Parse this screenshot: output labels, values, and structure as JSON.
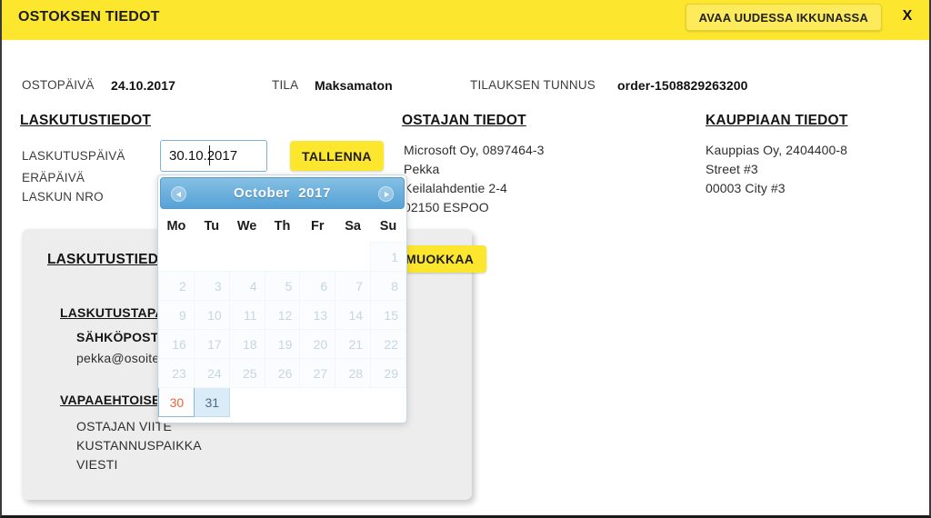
{
  "header": {
    "title": "OSTOKSEN TIEDOT",
    "open_new_window_label": "AVAA UUDESSA IKKUNASSA",
    "close_label": "X",
    "background_color": "#fde62e",
    "button_color": "#fdeb5c"
  },
  "summary": {
    "purchase_date_label": "OSTOPÄIVÄ",
    "purchase_date_value": "24.10.2017",
    "status_label": "TILA",
    "status_value": "Maksamaton",
    "order_id_label": "TILAUKSEN TUNNUS",
    "order_id_value": "order-1508829263200"
  },
  "sections": {
    "billing_title": "LASKUTUSTIEDOT",
    "buyer_title": "OSTAJAN TIEDOT",
    "merchant_title": "KAUPPIAAN TIEDOT"
  },
  "billing": {
    "invoice_date_label": "LASKUTUSPÄIVÄ",
    "due_date_label": "ERÄPÄIVÄ",
    "invoice_number_label": "LASKUN NRO",
    "invoice_date_value": "30.10.2017",
    "save_label": "TALLENNA"
  },
  "buyer": {
    "lines": [
      "Microsoft Oy, 0897464-3",
      "Pekka",
      "Keilalahdentie 2-4",
      "02150 ESPOO"
    ]
  },
  "merchant": {
    "lines": [
      "Kauppias Oy, 2404400-8",
      "Street #3",
      "00003 City #3"
    ]
  },
  "card": {
    "title": "LASKUTUSTIEDOT",
    "edit_label": "MUOKKAA",
    "billing_method_title": "LASKUTUSTAPA",
    "email_label": "SÄHKÖPOSTILASKU",
    "email_value": "pekka@osoite.fi",
    "optional_title": "VAPAAEHTOISET TIEDOT",
    "optional_rows": [
      "OSTAJAN VIITE",
      "KUSTANNUSPAIKKA",
      "VIESTI"
    ]
  },
  "datepicker": {
    "month": "October",
    "year": "2017",
    "prev_label": "prev-month",
    "next_label": "next-month",
    "weekdays": [
      "Mo",
      "Tu",
      "We",
      "Th",
      "Fr",
      "Sa",
      "Su"
    ],
    "leading_blanks": 6,
    "days": [
      1,
      2,
      3,
      4,
      5,
      6,
      7,
      8,
      9,
      10,
      11,
      12,
      13,
      14,
      15,
      16,
      17,
      18,
      19,
      20,
      21,
      22,
      23,
      24,
      25,
      26,
      27,
      28,
      29,
      30,
      31
    ],
    "today": 30,
    "selected": 31,
    "today_color": "#e4673b",
    "selected_bg": "#d9ecf8",
    "header_color": "#6cb0dd"
  }
}
